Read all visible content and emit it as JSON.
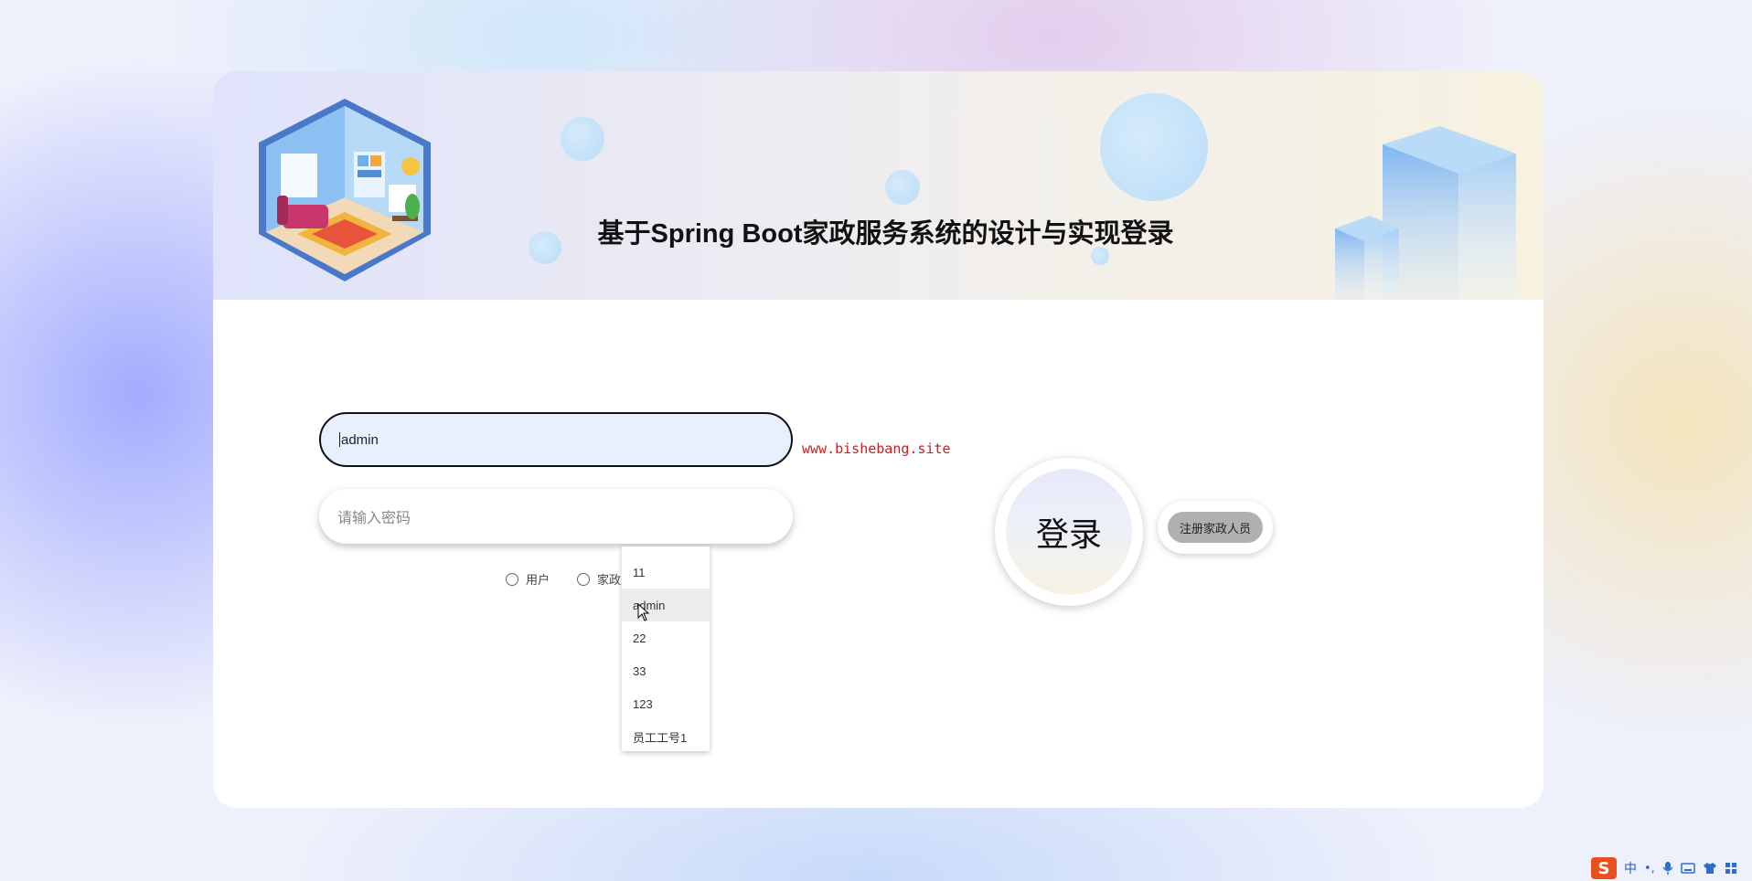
{
  "header": {
    "title": "基于Spring Boot家政服务系统的设计与实现登录"
  },
  "form": {
    "username_value": "admin",
    "password_placeholder": "请输入密码",
    "watermark": "www.bishebang.site",
    "roles": [
      {
        "label": "用户"
      },
      {
        "label": "家政人员"
      }
    ],
    "login_label": "登录",
    "register_label": "注册家政人员"
  },
  "autocomplete": {
    "items": [
      "11",
      "admin",
      "22",
      "33",
      "123",
      "员工工号1"
    ],
    "highlighted_index": 1
  },
  "taskbar": {
    "ime_logo": "S",
    "ime_mode": "中",
    "ime_punct": "•,"
  },
  "colors": {
    "watermark": "#c81e1e",
    "input_focus_bg": "#e8f0fe",
    "register_bg": "#b0b0b0",
    "ime_orange": "#e8501e"
  }
}
